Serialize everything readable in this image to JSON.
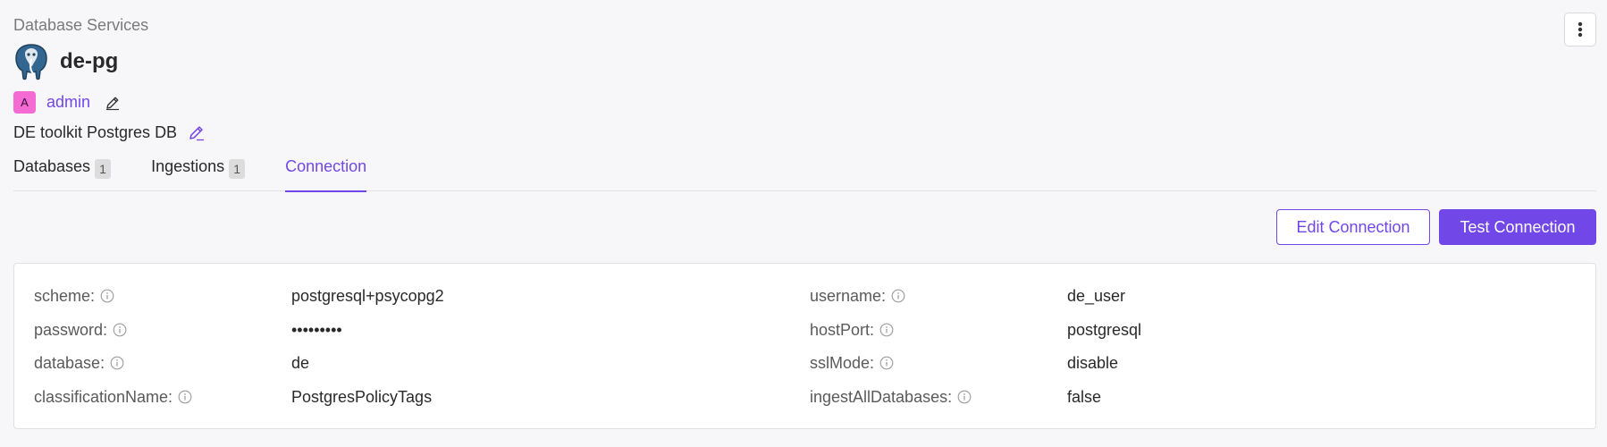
{
  "header": {
    "breadcrumb": "Database Services",
    "service_name": "de-pg",
    "logo_icon": "postgres-elephant-icon",
    "more_icon": "kebab-menu-icon"
  },
  "owner": {
    "avatar_initial": "A",
    "avatar_color": "#f46bd3",
    "name": "admin",
    "edit_icon": "pencil-icon"
  },
  "description": {
    "text": "DE toolkit Postgres DB",
    "edit_icon": "pencil-icon"
  },
  "tabs": [
    {
      "label": "Databases",
      "count": "1",
      "active": false
    },
    {
      "label": "Ingestions",
      "count": "1",
      "active": false
    },
    {
      "label": "Connection",
      "count": null,
      "active": true
    }
  ],
  "actions": {
    "edit_label": "Edit Connection",
    "test_label": "Test Connection"
  },
  "connection": {
    "left": [
      {
        "key": "scheme:",
        "value": "postgresql+psycopg2"
      },
      {
        "key": "password:",
        "value": "•••••••••"
      },
      {
        "key": "database:",
        "value": "de"
      },
      {
        "key": "classificationName:",
        "value": "PostgresPolicyTags"
      }
    ],
    "right": [
      {
        "key": "username:",
        "value": "de_user"
      },
      {
        "key": "hostPort:",
        "value": "postgresql"
      },
      {
        "key": "sslMode:",
        "value": "disable"
      },
      {
        "key": "ingestAllDatabases:",
        "value": "false"
      }
    ]
  },
  "colors": {
    "accent": "#7147e8",
    "background": "#f7f7fa"
  }
}
